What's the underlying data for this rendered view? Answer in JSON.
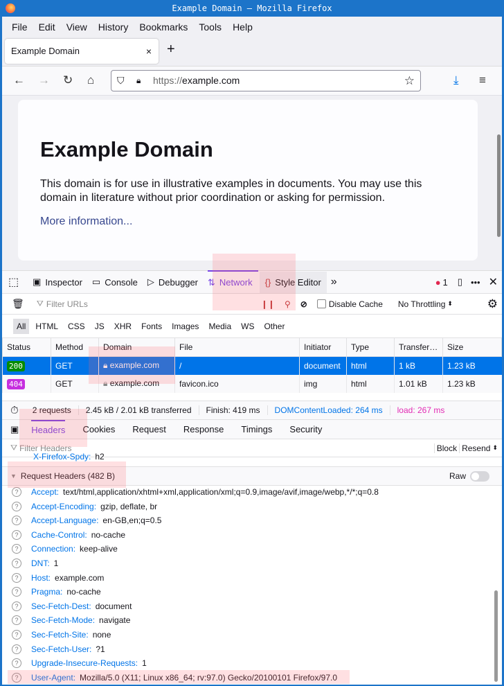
{
  "window": {
    "title": "Example Domain — Mozilla Firefox"
  },
  "menu": [
    "File",
    "Edit",
    "View",
    "History",
    "Bookmarks",
    "Tools",
    "Help"
  ],
  "tab": {
    "title": "Example Domain",
    "close": "×",
    "new": "+"
  },
  "url": {
    "scheme": "https://",
    "host": "example.com"
  },
  "page": {
    "heading": "Example Domain",
    "body": "This domain is for use in illustrative examples in documents. You may use this domain in literature without prior coordination or asking for permission.",
    "link": "More information..."
  },
  "devtools": {
    "tabs": [
      "Inspector",
      "Console",
      "Debugger",
      "Network",
      "Style Editor"
    ],
    "error_count": "1",
    "filter_placeholder": "Filter URLs",
    "disable_cache": "Disable Cache",
    "throttling": "No Throttling",
    "types": [
      "All",
      "HTML",
      "CSS",
      "JS",
      "XHR",
      "Fonts",
      "Images",
      "Media",
      "WS",
      "Other"
    ],
    "columns": [
      "Status",
      "Method",
      "Domain",
      "File",
      "Initiator",
      "Type",
      "Transfer…",
      "Size"
    ],
    "requests": [
      {
        "status": "200",
        "status_color": "#058b00",
        "method": "GET",
        "domain": "example.com",
        "file": "/",
        "initiator": "document",
        "type": "html",
        "transferred": "1 kB",
        "size": "1.23 kB"
      },
      {
        "status": "404",
        "status_color": "#c62fdf",
        "method": "GET",
        "domain": "example.com",
        "file": "favicon.ico",
        "initiator": "img",
        "type": "html",
        "transferred": "1.01 kB",
        "size": "1.23 kB"
      }
    ],
    "summary": {
      "requests": "2 requests",
      "transferred": "2.45 kB / 2.01 kB transferred",
      "finish": "Finish: 419 ms",
      "dcl": "DOMContentLoaded: 264 ms",
      "load": "load: 267 ms"
    },
    "detail_tabs": [
      "Headers",
      "Cookies",
      "Request",
      "Response",
      "Timings",
      "Security"
    ],
    "filter_headers": "Filter Headers",
    "block": "Block",
    "resend": "Resend",
    "partial_header": {
      "name": "X-Firefox-Spdy:",
      "value": "h2"
    },
    "request_headers_title": "Request Headers (482 B)",
    "raw": "Raw",
    "headers": [
      {
        "name": "Accept:",
        "value": "text/html,application/xhtml+xml,application/xml;q=0.9,image/avif,image/webp,*/*;q=0.8"
      },
      {
        "name": "Accept-Encoding:",
        "value": "gzip, deflate, br"
      },
      {
        "name": "Accept-Language:",
        "value": "en-GB,en;q=0.5"
      },
      {
        "name": "Cache-Control:",
        "value": "no-cache"
      },
      {
        "name": "Connection:",
        "value": "keep-alive"
      },
      {
        "name": "DNT:",
        "value": "1"
      },
      {
        "name": "Host:",
        "value": "example.com"
      },
      {
        "name": "Pragma:",
        "value": "no-cache"
      },
      {
        "name": "Sec-Fetch-Dest:",
        "value": "document"
      },
      {
        "name": "Sec-Fetch-Mode:",
        "value": "navigate"
      },
      {
        "name": "Sec-Fetch-Site:",
        "value": "none"
      },
      {
        "name": "Sec-Fetch-User:",
        "value": "?1"
      },
      {
        "name": "Upgrade-Insecure-Requests:",
        "value": "1"
      },
      {
        "name": "User-Agent:",
        "value": "Mozilla/5.0 (X11; Linux x86_64; rv:97.0) Gecko/20100101 Firefox/97.0"
      }
    ]
  }
}
